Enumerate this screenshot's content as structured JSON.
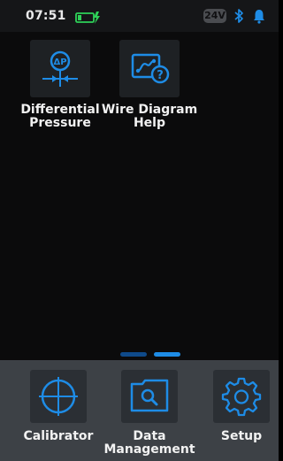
{
  "status_bar": {
    "time": "07:51",
    "voltage": "24V",
    "battery_icon": "battery-charging-icon",
    "bluetooth_icon": "bluetooth-icon",
    "notification_icon": "bell-icon"
  },
  "apps": [
    {
      "label": "Differential\nPressure",
      "icon": "differential-pressure-icon"
    },
    {
      "label": "Wire Diagram\nHelp",
      "icon": "wire-diagram-help-icon"
    }
  ],
  "page_indicator": {
    "pages": 2,
    "current": 2
  },
  "dock": [
    {
      "label": "Calibrator",
      "icon": "calibrator-icon"
    },
    {
      "label": "Data\nManagement",
      "icon": "data-management-icon"
    },
    {
      "label": "Setup",
      "icon": "gear-icon"
    }
  ],
  "colors": {
    "accent": "#1e8ce6",
    "battery": "#2ed158",
    "background": "#0b0b0c",
    "dock": "#3d4146"
  }
}
